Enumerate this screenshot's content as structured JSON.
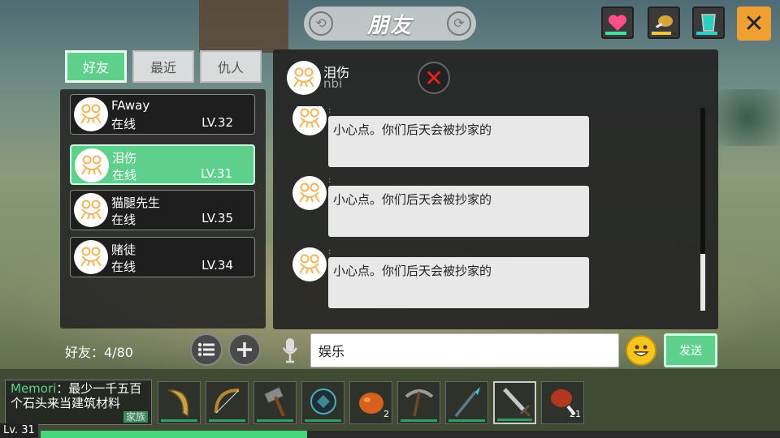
{
  "title": "朋友",
  "tabs": [
    {
      "label": "好友",
      "active": true
    },
    {
      "label": "最近",
      "active": false
    },
    {
      "label": "仇人",
      "active": false
    }
  ],
  "friends": [
    {
      "name": "FAway",
      "status": "在线",
      "level": "LV.32",
      "selected": false
    },
    {
      "name": "泪伤",
      "status": "在线",
      "level": "LV.31",
      "selected": true
    },
    {
      "name": "猫腿先生",
      "status": "在线",
      "level": "LV.35",
      "selected": false
    },
    {
      "name": "赌徒",
      "status": "在线",
      "level": "LV.34",
      "selected": false
    }
  ],
  "friend_count": "好友：4/80",
  "chat": {
    "name": "泪伤",
    "subtitle": "nbi",
    "messages": [
      {
        "text": "小心点。你们后天会被抄家的"
      },
      {
        "text": "小心点。你们后天会被抄家的"
      },
      {
        "text": "小心点。你们后天会被抄家的"
      }
    ]
  },
  "input": {
    "value": "娱乐"
  },
  "send_label": "发送",
  "notice": {
    "author": "Memori",
    "text": "：最少一千五百个石头来当建筑材料",
    "tag": "家族"
  },
  "status_meters": {
    "health": 0.85,
    "hunger": 0.8,
    "thirst": 0.85
  },
  "hotbar": [
    {
      "icon": "curved-blade-icon",
      "count": "",
      "selected": false
    },
    {
      "icon": "bow-icon",
      "count": "",
      "selected": false
    },
    {
      "icon": "stone-hammer-icon",
      "count": "",
      "selected": false
    },
    {
      "icon": "orb-icon",
      "count": "",
      "selected": false
    },
    {
      "icon": "fruit-icon",
      "count": "2",
      "selected": false
    },
    {
      "icon": "pickaxe-icon",
      "count": "",
      "selected": false
    },
    {
      "icon": "spear-icon",
      "count": "",
      "selected": false
    },
    {
      "icon": "sword-icon",
      "count": "",
      "selected": true
    },
    {
      "icon": "meat-icon",
      "count": "21",
      "selected": false
    }
  ],
  "player": {
    "level": "Lv. 31",
    "xp_fraction": 0.36
  },
  "colors": {
    "accent_green": "#5ed08c",
    "close_orange": "#f0a030"
  }
}
